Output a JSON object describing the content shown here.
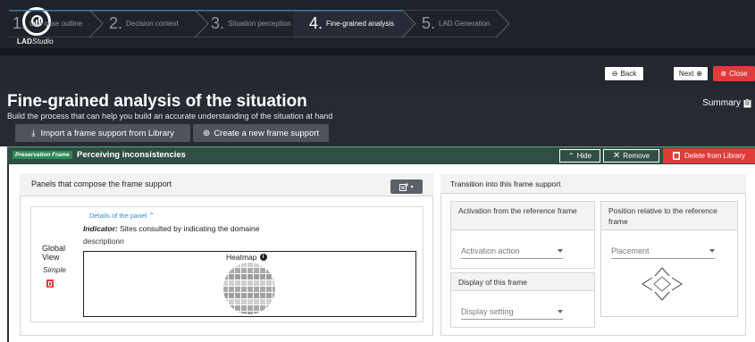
{
  "app": {
    "logo_text": "LAD",
    "logo_text_suffix": "Studio"
  },
  "steps": [
    {
      "num": "1.",
      "label": "Use case outline",
      "active": false
    },
    {
      "num": "2.",
      "label": "Decision context",
      "active": false
    },
    {
      "num": "3.",
      "label": "Situation perception",
      "active": false
    },
    {
      "num": "4.",
      "label": "Fine-grained analysis",
      "active": true
    },
    {
      "num": "5.",
      "label": "LAD Generation",
      "active": false
    }
  ],
  "nav": {
    "back_label": "Back",
    "next_label": "Next",
    "close_label": "Close"
  },
  "header": {
    "title": "Fine-grained analysis of the situation",
    "subtitle": "Build the process that can help you build an accurate understanding of the situation at hand",
    "summary_label": "Summary",
    "import_label": "Import a frame support from Library",
    "create_label": "Create a new frame support"
  },
  "frame": {
    "badge": "Preservation Frame",
    "title": "Perceiving inconsistencies",
    "hide_label": "Hide",
    "remove_label": "Remove",
    "delete_label": "Delete from Library"
  },
  "panels_card": {
    "title": "Panels that compose the frame support",
    "details_label": "Details of the panel",
    "indicator_prefix": "Indicator:",
    "indicator_value": " Sites consulted by indicating the domaine",
    "description": "descriptionn",
    "view_label_1": "Global",
    "view_label_2": "View",
    "view_type": "Simple",
    "chart_title": "Heatmap"
  },
  "transition_card": {
    "title": "Transition into this frame support",
    "activation_title": "Activation from the reference frame",
    "activation_select": "Activation action",
    "display_title": "Display of this frame",
    "display_select": "Display setting",
    "position_title": "Position relative to the reference frame",
    "position_select": "Placement"
  },
  "colors": {
    "accent_red": "#e23a3a",
    "frame_green": "#2f4f44",
    "link_blue": "#2f8fcf",
    "header_dark": "#262a33"
  }
}
